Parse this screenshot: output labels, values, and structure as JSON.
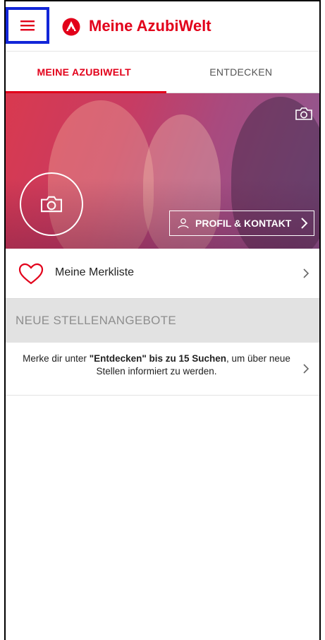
{
  "appbar": {
    "title": "Meine AzubiWelt",
    "brand_color": "#e2001a"
  },
  "tabs": [
    {
      "label": "MEINE AZUBIWELT",
      "active": true
    },
    {
      "label": "ENTDECKEN",
      "active": false
    }
  ],
  "hero": {
    "profile_button_label": "PROFIL & KONTAKT"
  },
  "merkliste": {
    "label": "Meine Merkliste"
  },
  "section": {
    "title": "NEUE STELLENANGEBOTE"
  },
  "info": {
    "part1": "Merke dir unter ",
    "bold1": "\"Entdecken\" bis zu 15 Suchen",
    "part2": ", um über neue Stellen informiert zu werden."
  },
  "icons": {
    "menu": "hamburger-icon",
    "logo": "arbeitsagentur-logo-icon",
    "camera": "camera-icon",
    "person": "person-icon",
    "heart": "heart-icon",
    "chevron": "chevron-right-icon"
  }
}
